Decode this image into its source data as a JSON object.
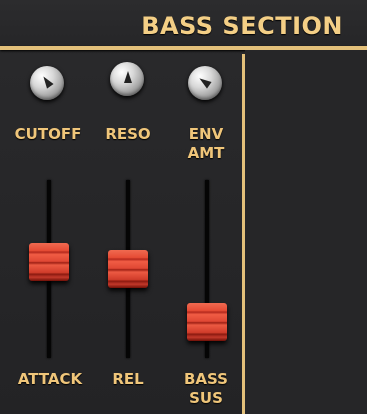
{
  "header": {
    "title": "BASS SECTION"
  },
  "knobs": [
    {
      "label": "CUTOFF",
      "icon": "knob-icon"
    },
    {
      "label": "RESO",
      "icon": "knob-icon"
    },
    {
      "label": "ENV AMT",
      "icon": "knob-icon"
    }
  ],
  "sliders": [
    {
      "label": "ATTACK",
      "level": 0.55
    },
    {
      "label": "REL",
      "level": 0.5
    },
    {
      "label": "BASS SUS",
      "level": 0.12
    }
  ],
  "colors": {
    "accent": "#e3c07a",
    "label": "#f0c67a",
    "fader": "#e04834",
    "background": "#262628"
  }
}
